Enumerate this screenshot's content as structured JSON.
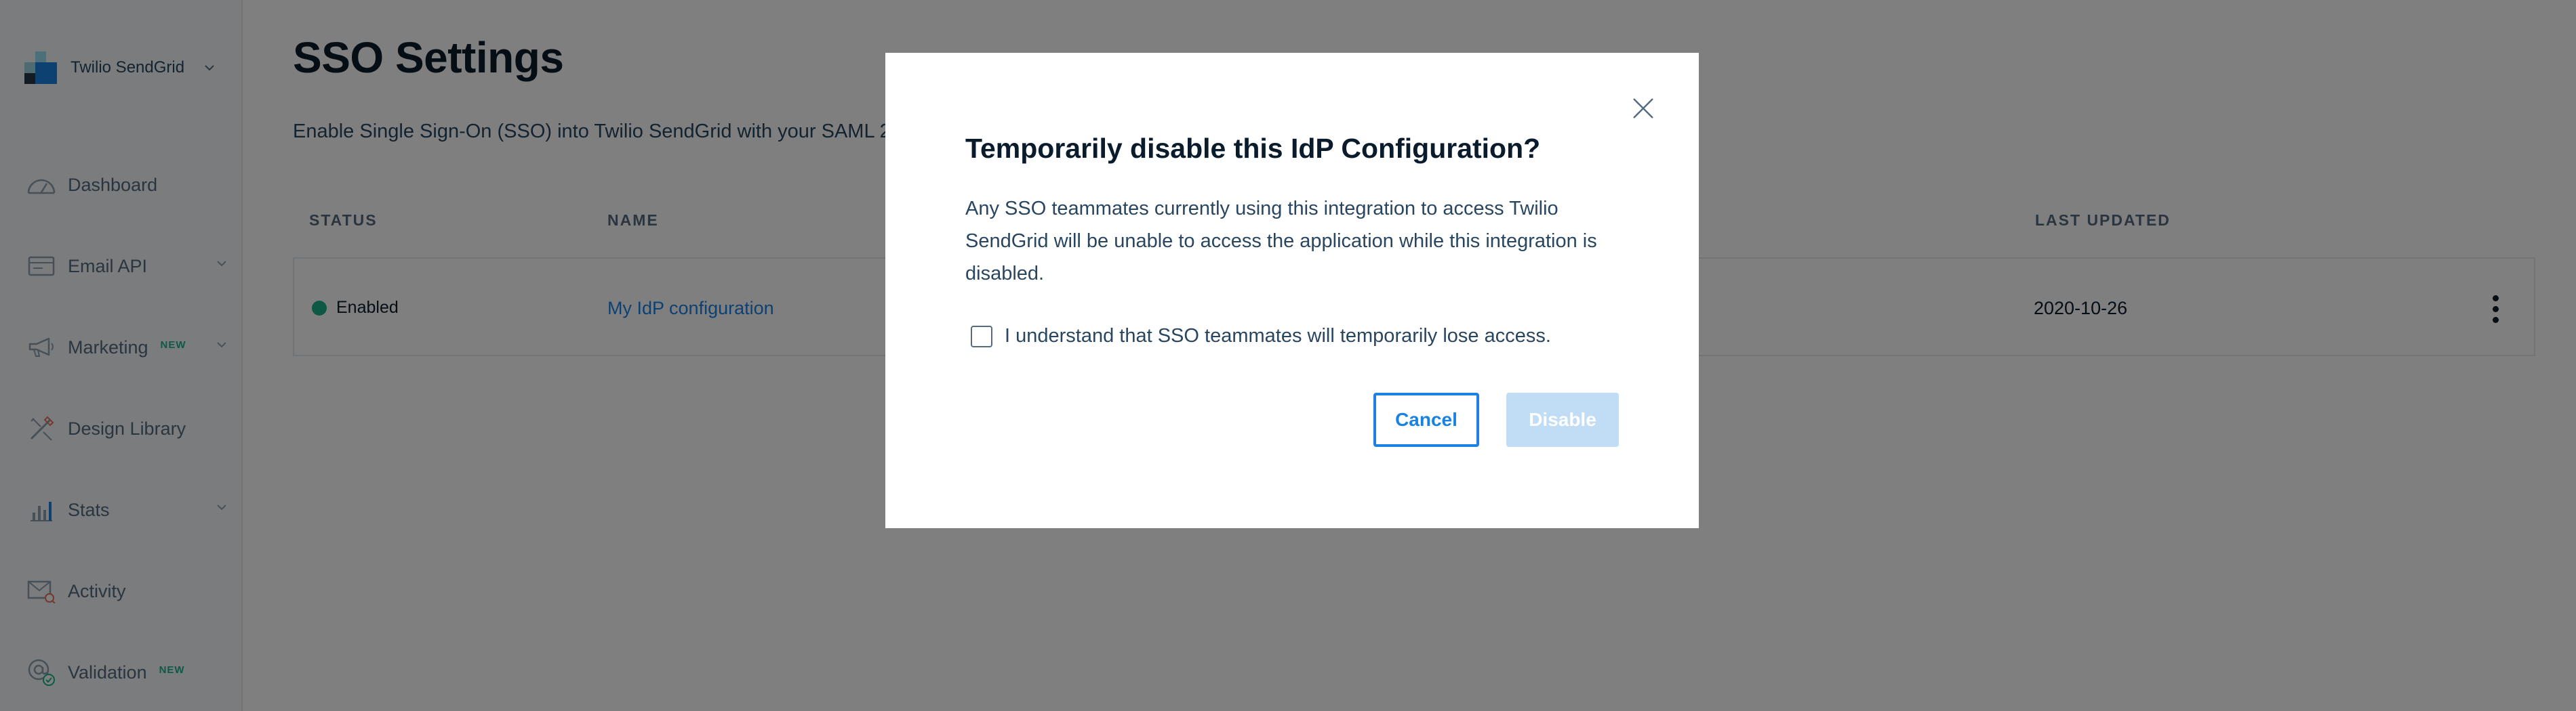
{
  "sidebar": {
    "brand": "Twilio SendGrid",
    "items": [
      {
        "label": "Dashboard",
        "icon": "dashboard-gauge-icon",
        "badge": "",
        "chevron": false
      },
      {
        "label": "Email API",
        "icon": "email-api-icon",
        "badge": "",
        "chevron": true
      },
      {
        "label": "Marketing",
        "icon": "megaphone-icon",
        "badge": "NEW",
        "chevron": true
      },
      {
        "label": "Design Library",
        "icon": "design-tools-icon",
        "badge": "",
        "chevron": false
      },
      {
        "label": "Stats",
        "icon": "stats-bars-icon",
        "badge": "",
        "chevron": true
      },
      {
        "label": "Activity",
        "icon": "activity-mail-icon",
        "badge": "",
        "chevron": false
      },
      {
        "label": "Validation",
        "icon": "validation-at-icon",
        "badge": "NEW",
        "chevron": false
      }
    ]
  },
  "page": {
    "title": "SSO Settings",
    "description": "Enable Single Sign-On (SSO) into Twilio SendGrid with your SAML 2.0"
  },
  "table": {
    "headers": {
      "status": "STATUS",
      "name": "NAME",
      "last_updated": "LAST UPDATED"
    },
    "rows": [
      {
        "status": "Enabled",
        "name": "My IdP configuration",
        "last_updated": "2020-10-26"
      }
    ]
  },
  "modal": {
    "title": "Temporarily disable this IdP Configuration?",
    "body": "Any SSO teammates currently using this integration to access Twilio SendGrid will be unable to access the application while this integration is disabled.",
    "checkbox_label": "I understand that SSO teammates will temporarily lose access.",
    "checkbox_checked": false,
    "cancel_label": "Cancel",
    "disable_label": "Disable"
  },
  "colors": {
    "accent": "#1a82e2",
    "status_enabled": "#1bb38d",
    "badge_new": "#1bb38d",
    "disabled_button": "#c0ddf5",
    "overlay": "rgba(0,0,0,0.5)"
  }
}
